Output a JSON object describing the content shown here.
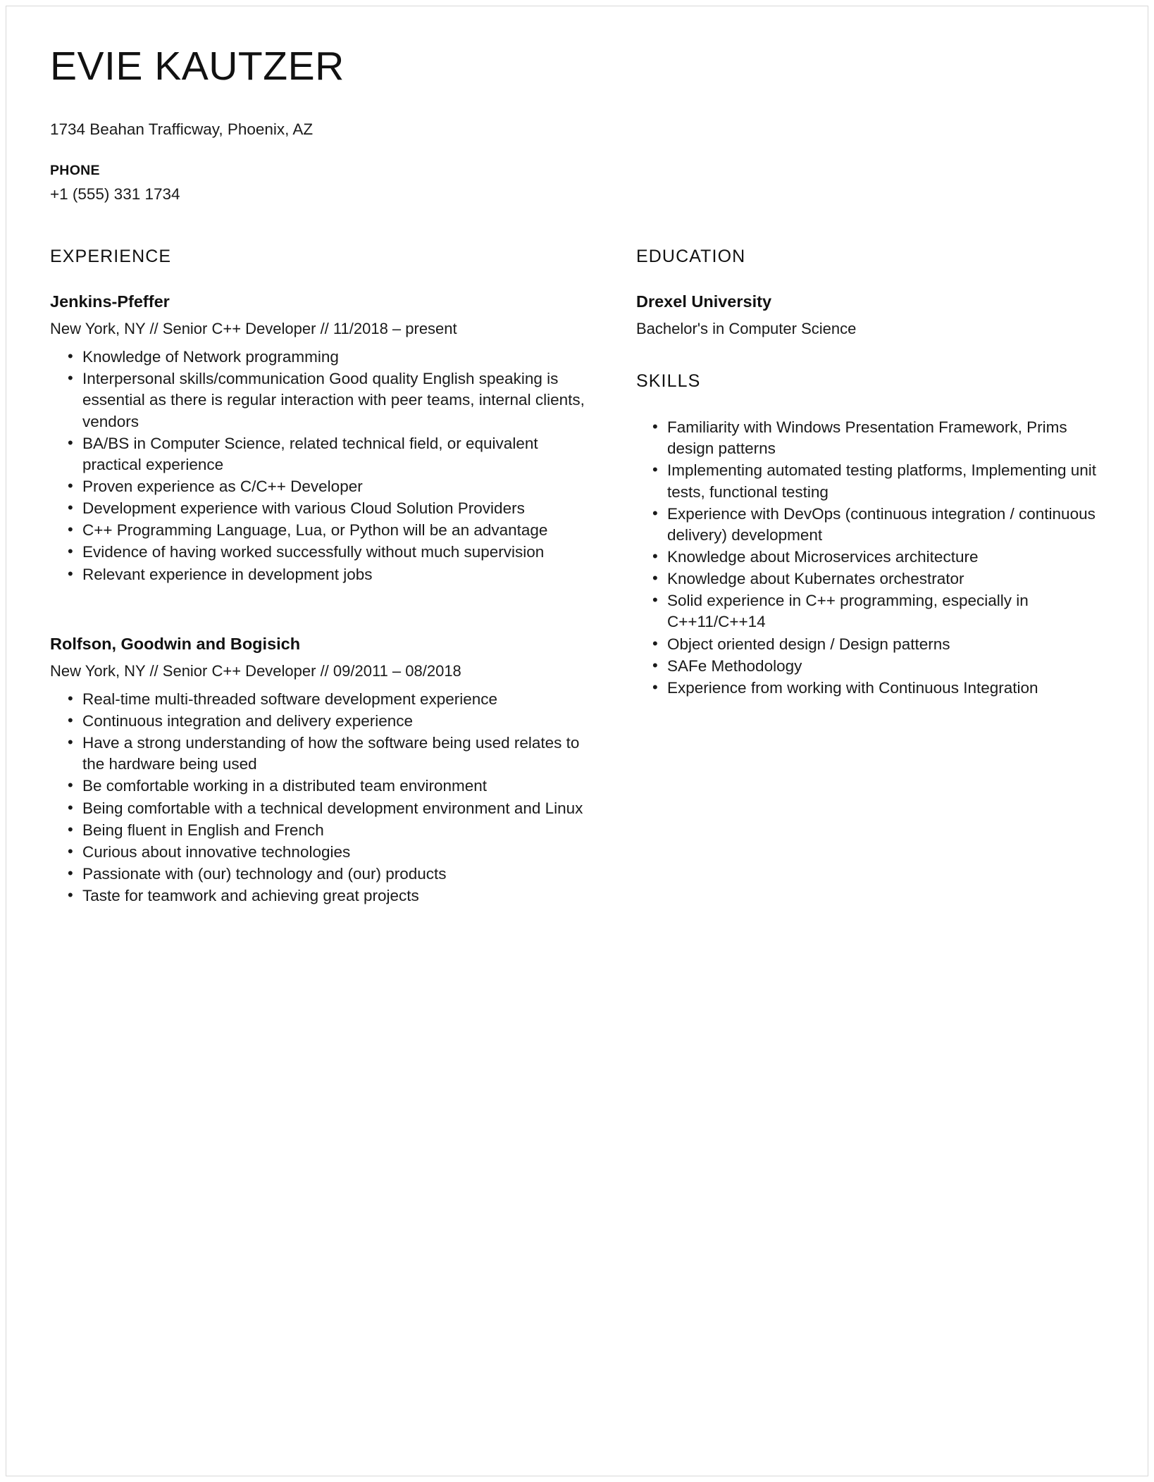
{
  "header": {
    "name": "EVIE KAUTZER",
    "address": "1734 Beahan Trafficway, Phoenix, AZ",
    "phone_label": "PHONE",
    "phone_value": "+1 (555) 331 1734"
  },
  "sections": {
    "experience_title": "EXPERIENCE",
    "education_title": "EDUCATION",
    "skills_title": "SKILLS"
  },
  "experience": [
    {
      "company": "Jenkins-Pfeffer",
      "meta": "New York, NY // Senior C++ Developer // 11/2018 – present",
      "bullets": [
        "Knowledge of Network programming",
        "Interpersonal skills/communication Good quality English speaking is essential as there is regular interaction with peer teams, internal clients, vendors",
        "BA/BS in Computer Science, related technical field, or equivalent practical experience",
        "Proven experience as C/C++ Developer",
        "Development experience with various Cloud Solution Providers",
        "C++ Programming Language, Lua, or Python will be an advantage",
        "Evidence of having worked successfully without much supervision",
        "Relevant experience in development jobs"
      ]
    },
    {
      "company": "Rolfson, Goodwin and Bogisich",
      "meta": "New York, NY // Senior C++ Developer // 09/2011 – 08/2018",
      "bullets": [
        "Real-time multi-threaded software development experience",
        "Continuous integration and delivery experience",
        "Have a strong understanding of how the software being used relates to the hardware being used",
        "Be comfortable working in a distributed team environment",
        "Being comfortable with a technical development environment and Linux",
        "Being fluent in English and French",
        "Curious about innovative technologies",
        "Passionate with (our) technology and (our) products",
        "Taste for teamwork and achieving great projects"
      ]
    }
  ],
  "education": [
    {
      "school": "Drexel University",
      "degree": "Bachelor's in Computer Science"
    }
  ],
  "skills": [
    "Familiarity with Windows Presentation Framework, Prims design patterns",
    "Implementing automated testing platforms, Implementing unit tests, functional testing",
    "Experience with DevOps (continuous integration / continuous delivery) development",
    "Knowledge about Microservices architecture",
    "Knowledge about Kubernates orchestrator",
    "Solid experience in C++ programming, especially in C++11/C++14",
    "Object oriented design / Design patterns",
    "SAFe Methodology",
    "Experience from working with Continuous Integration"
  ],
  "colors": {
    "text": "#1a1a1a",
    "heading": "#111111",
    "page_border": "#d9d9d9",
    "background": "#ffffff"
  }
}
